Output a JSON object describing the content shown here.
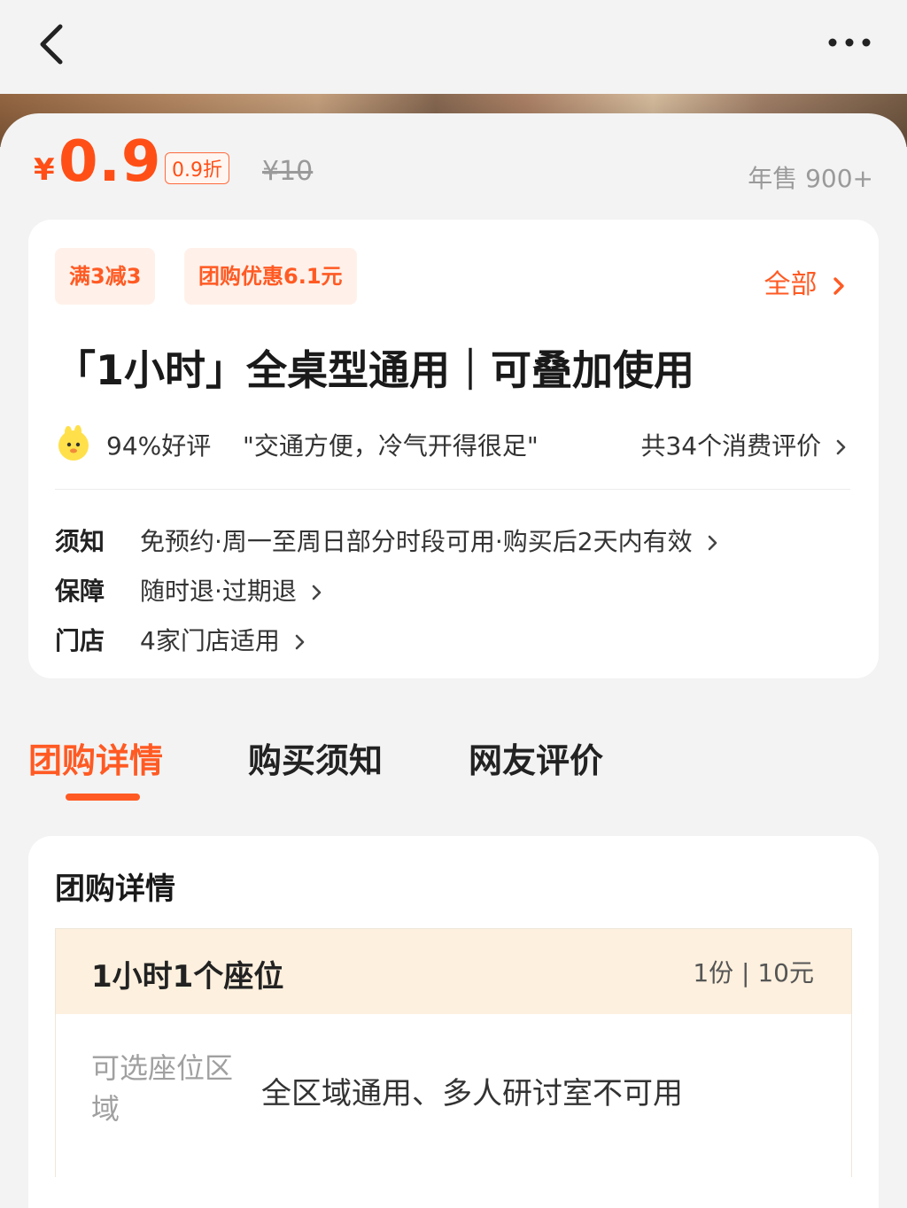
{
  "nav": {
    "back_icon": "chevron-left-icon",
    "more_icon": "more-dots-icon"
  },
  "price": {
    "currency_symbol": "¥",
    "current": "0.9",
    "discount_badge": "0.9折",
    "original": "¥10",
    "annual_sales": "年售 900+"
  },
  "offers": {
    "tags": [
      "满3减3",
      "团购优惠6.1元"
    ],
    "all_label": "全部"
  },
  "deal": {
    "title": "「1小时」全桌型通用｜可叠加使用",
    "review_rate": "94%好评",
    "review_quote": "\"交通方便，冷气开得很足\"",
    "review_count": "共34个消费评价"
  },
  "info": [
    {
      "key": "须知",
      "value": "免预约·周一至周日部分时段可用·购买后2天内有效"
    },
    {
      "key": "保障",
      "value": "随时退·过期退"
    },
    {
      "key": "门店",
      "value": "4家门店适用"
    }
  ],
  "tabs": [
    "团购详情",
    "购买须知",
    "网友评价"
  ],
  "details": {
    "section_title": "团购详情",
    "package_name": "1小时1个座位",
    "package_qty": "1份 | 10元",
    "seat_label": "可选座位区域",
    "seat_value": "全区域通用、多人研讨室不可用"
  },
  "colors": {
    "accent": "#ff5a23",
    "tag_bg": "#fff1ea",
    "table_head_bg": "#fdf0de"
  }
}
